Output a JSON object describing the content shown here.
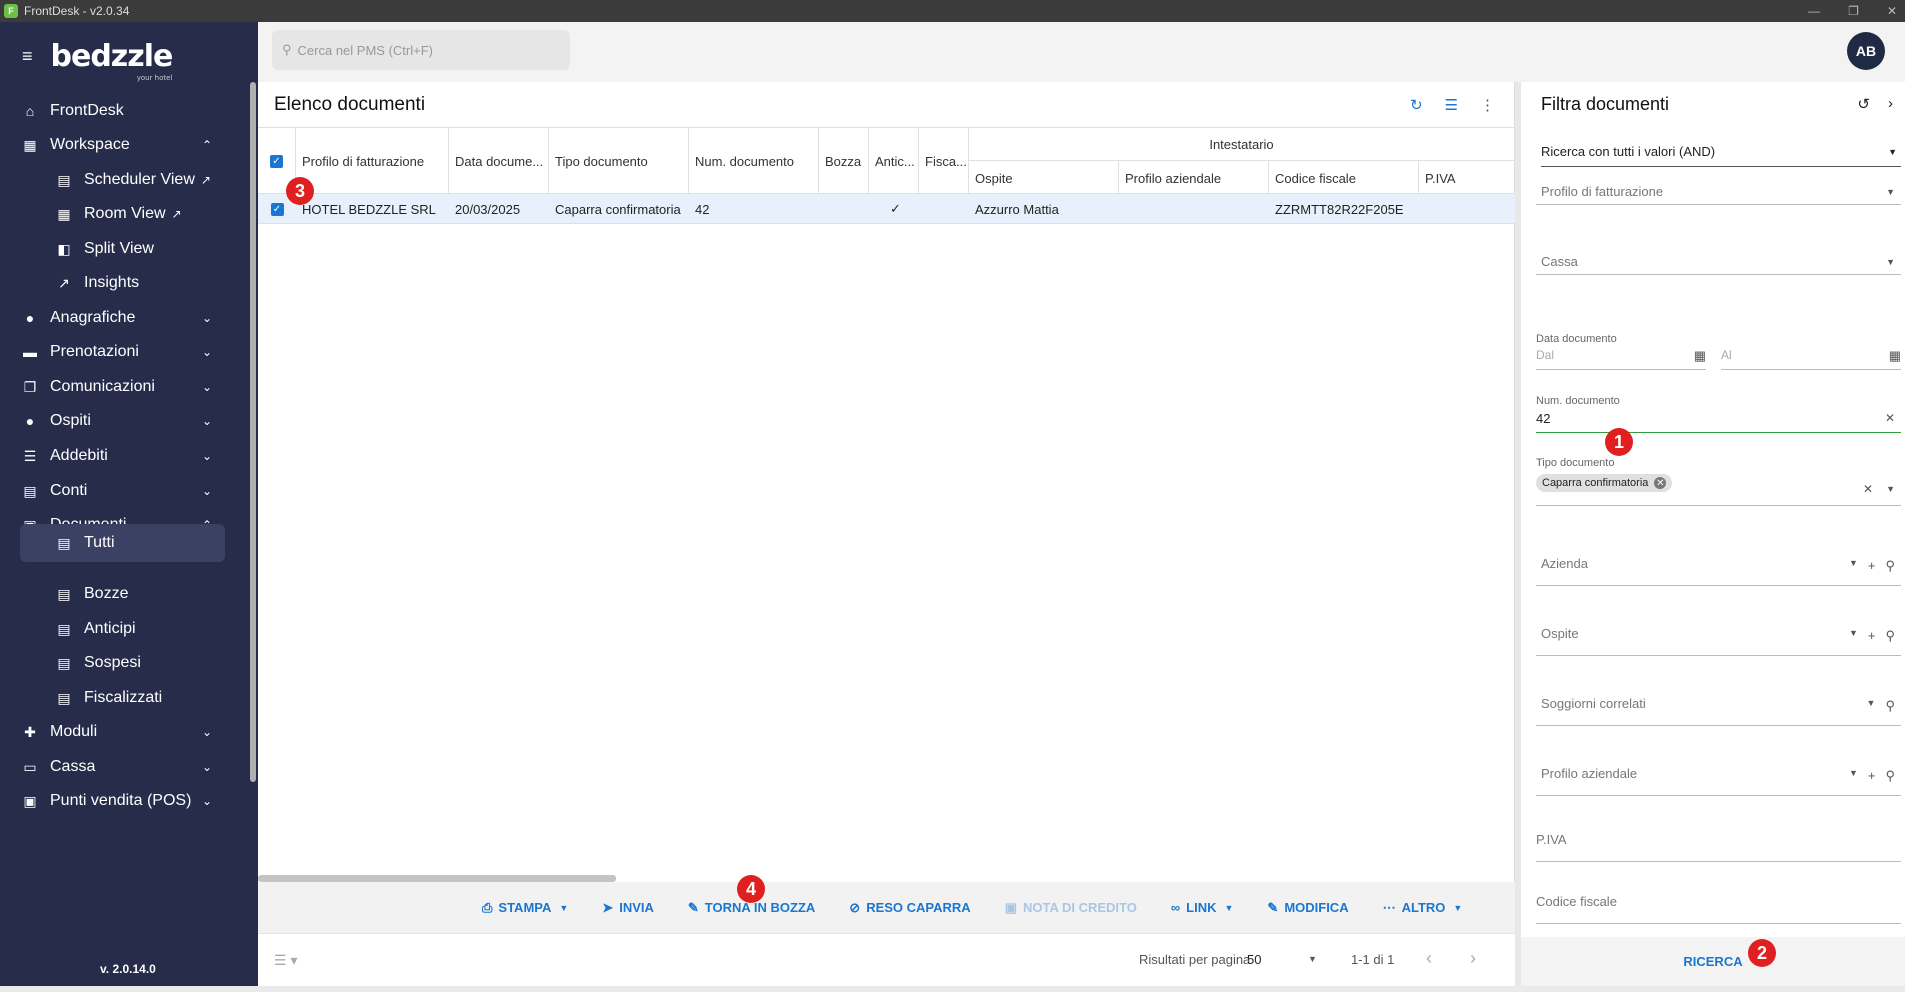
{
  "window": {
    "title": "FrontDesk - v2.0.34",
    "logo_glyph": "F"
  },
  "sidebar": {
    "brand": "bedzzle",
    "brand_sub": "your hotel",
    "items": [
      {
        "label": "FrontDesk",
        "icon": "home-icon"
      },
      {
        "label": "Workspace",
        "icon": "dashboard-icon",
        "expanded": true
      },
      {
        "label": "Scheduler View",
        "icon": "calendar-icon",
        "external": true
      },
      {
        "label": "Room View",
        "icon": "grid-icon",
        "external": true
      },
      {
        "label": "Split View",
        "icon": "split-icon"
      },
      {
        "label": "Insights",
        "icon": "trend-icon"
      },
      {
        "label": "Anagrafiche",
        "icon": "person-icon"
      },
      {
        "label": "Prenotazioni",
        "icon": "bed-icon"
      },
      {
        "label": "Comunicazioni",
        "icon": "copy-icon"
      },
      {
        "label": "Ospiti",
        "icon": "guest-icon"
      },
      {
        "label": "Addebiti",
        "icon": "list-icon"
      },
      {
        "label": "Conti",
        "icon": "receipt-icon"
      },
      {
        "label": "Documenti",
        "icon": "document-icon",
        "expanded": true
      },
      {
        "label": "Tutti",
        "icon": "doc-icon",
        "active": true
      },
      {
        "label": "Bozze",
        "icon": "doc-icon"
      },
      {
        "label": "Anticipi",
        "icon": "doc-icon"
      },
      {
        "label": "Sospesi",
        "icon": "doc-icon"
      },
      {
        "label": "Fiscalizzati",
        "icon": "doc-icon"
      },
      {
        "label": "Moduli",
        "icon": "puzzle-icon"
      },
      {
        "label": "Cassa",
        "icon": "cash-icon"
      },
      {
        "label": "Punti vendita (POS)",
        "icon": "pos-icon"
      }
    ],
    "version": "v. 2.0.14.0"
  },
  "topbar": {
    "search_placeholder": "Cerca nel PMS (Ctrl+F)",
    "avatar": "AB"
  },
  "main": {
    "title": "Elenco documenti",
    "columns": {
      "profilo": "Profilo di fatturazione",
      "data": "Data docume...",
      "tipo": "Tipo documento",
      "num": "Num. documento",
      "bozza": "Bozza",
      "antic": "Antic...",
      "fisca": "Fisca...",
      "group": "Intestatario",
      "ospite": "Ospite",
      "profilo_az": "Profilo aziendale",
      "cf": "Codice fiscale",
      "piva": "P.IVA"
    },
    "rows": [
      {
        "profilo": "HOTEL BEDZZLE SRL",
        "data": "20/03/2025",
        "tipo": "Caparra confirmatoria",
        "num": "42",
        "antic": "✓",
        "ospite": "Azzurro Mattia",
        "cf": "ZZRMTT82R22F205E"
      }
    ],
    "actions": {
      "stampa": "STAMPA",
      "invia": "INVIA",
      "torna": "TORNA IN BOZZA",
      "reso": "RESO CAPARRA",
      "nota": "NOTA DI CREDITO",
      "link": "LINK",
      "modifica": "MODIFICA",
      "altro": "ALTRO"
    },
    "footer": {
      "rpp_label": "Risultati per pagina",
      "rpp_value": "50",
      "range": "1-1 di 1"
    }
  },
  "filter": {
    "title": "Filtra documenti",
    "mode": "Ricerca con tutti i valori (AND)",
    "profilo": "Profilo di fatturazione",
    "cassa": "Cassa",
    "data_label": "Data documento",
    "dal": "Dal",
    "al": "Al",
    "num_label": "Num. documento",
    "num_value": "42",
    "tipo_label": "Tipo documento",
    "tipo_chip": "Caparra confirmatoria",
    "azienda": "Azienda",
    "ospite": "Ospite",
    "soggiorni": "Soggiorni correlati",
    "profilo_az": "Profilo aziendale",
    "piva": "P.IVA",
    "cf": "Codice fiscale",
    "search_button": "RICERCA"
  },
  "badges": {
    "b1": "1",
    "b2": "2",
    "b3": "3",
    "b4": "4"
  },
  "colors": {
    "sidebar": "#262c49",
    "accent": "#1976d2",
    "badge": "#e02020",
    "row_selected": "#e8f1fb"
  }
}
